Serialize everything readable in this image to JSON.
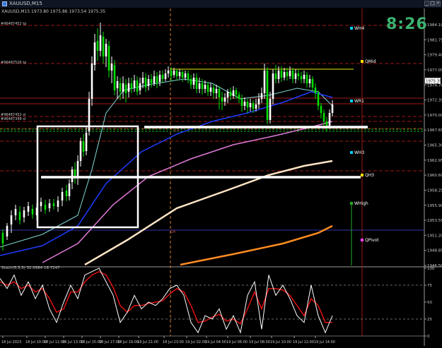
{
  "window": {
    "title": "XAUUSD,M15"
  },
  "chart_info": "XAUUSD,M15  1973.80 1975.86 1973.54 1975.35",
  "clock": "8:26",
  "price_scale": [
    "1984.10",
    "1981.75",
    "1979.40",
    "1977.05",
    "1974.70",
    "1972.35",
    "1970.00",
    "1967.65",
    "1965.30",
    "1962.95",
    "1960.60",
    "1958.25",
    "1955.90",
    "1953.55",
    "1951.20",
    "1948.85",
    "1946.50"
  ],
  "current_price": "1975.35",
  "order_labels": [
    "#96487452 tp",
    "#96487526 tp",
    "#96487452 sl",
    "#96487348 sl"
  ],
  "level_labels": [
    "WH4",
    "QMid",
    "WR1",
    "WH3",
    "QH3",
    "WHigh",
    "QPivot"
  ],
  "level_colors": {
    "WH4": "#00d0ff",
    "QMid": "#ffe000",
    "WR1": "#00d0ff",
    "WH3": "#00d0ff",
    "QH3": "#ffe000",
    "WHigh": "#22aa22",
    "QPivot": "#ff44ff"
  },
  "sub_labels": [
    "sl 1",
    "G4"
  ],
  "oscillator": {
    "label": "Stoch(5,3,3) 32.0584 18.7247",
    "scale": [
      "100",
      "75",
      "50",
      "25",
      "0"
    ]
  },
  "time_axis": [
    "18 Jul 2023",
    "18 Jul 10:00",
    "18 Jul 11:00",
    "18 Jul 13:00",
    "18 Jul 15:00",
    "18 Jul 17:00",
    "18 Jul 19:00",
    "18 Jul 21:00",
    "18 Jul 23:00",
    "19 Jul 02:00",
    "19 Jul 04:00",
    "19 Jul 06:00",
    "19 Jul 08:00",
    "19 Jul 10:00",
    "19 Jul 12:00",
    "19 Jul 14:00"
  ],
  "colors": {
    "bull": "#ffffff",
    "bear": "#00e000",
    "ema_fast": "#7fd8d8",
    "ema_mid": "#1e3cff",
    "ma_pink": "#e07ad8",
    "ma_cream": "#ffe4c4",
    "ma_orange": "#ff8c20",
    "stoch_main": "#ffffff",
    "stoch_signal": "#e01010"
  }
}
